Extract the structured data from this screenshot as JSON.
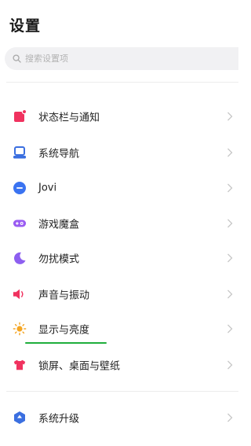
{
  "header": {
    "title": "设置"
  },
  "search": {
    "placeholder": "搜索设置项",
    "icon": "search-icon"
  },
  "settings": {
    "items": [
      {
        "label": "状态栏与通知",
        "icon": "notification-icon",
        "color": "#f0325f"
      },
      {
        "label": "系统导航",
        "icon": "navigation-icon",
        "color": "#3b6fe0"
      },
      {
        "label": "Jovi",
        "icon": "jovi-icon",
        "color": "#3a73f1"
      },
      {
        "label": "游戏魔盒",
        "icon": "game-box-icon",
        "color": "#9a5cf2"
      },
      {
        "label": "勿扰模式",
        "icon": "moon-icon",
        "color": "#8d5ff0"
      },
      {
        "label": "声音与振动",
        "icon": "speaker-icon",
        "color": "#f0325f"
      },
      {
        "label": "显示与亮度",
        "icon": "sun-icon",
        "color": "#f5a623"
      },
      {
        "label": "锁屏、桌面与壁纸",
        "icon": "tshirt-icon",
        "color": "#f0325f"
      },
      {
        "label": "系统升级",
        "icon": "system-update-icon",
        "color": "#3b6fe0"
      }
    ]
  },
  "colors": {
    "highlight_underline": "#1fae3c",
    "chevron": "#c7c7c7"
  }
}
